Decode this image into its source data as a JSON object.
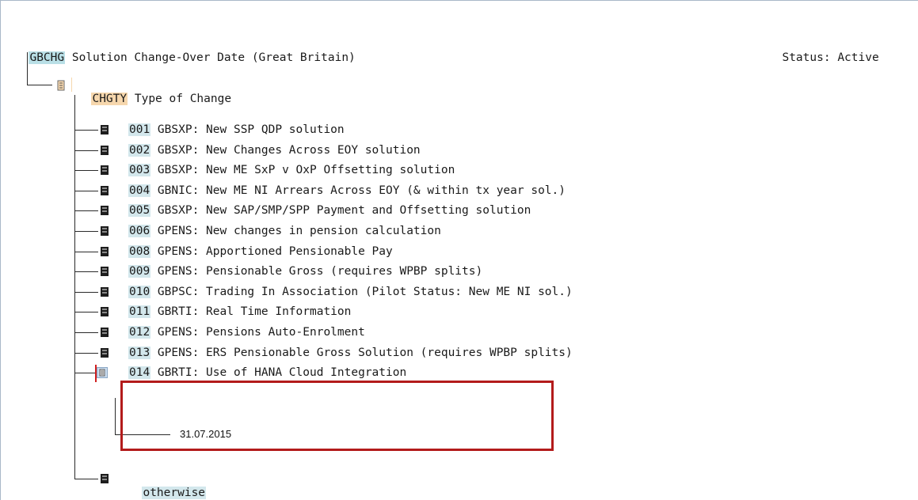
{
  "header": {
    "root_key": "GBCHG",
    "root_text": " Solution Change-Over Date (Great Britain)",
    "status_label": "Status:",
    "status_value": "Active"
  },
  "chgty": {
    "key": "CHGTY",
    "text": " Type of Change"
  },
  "options": [
    {
      "code": "001",
      "text": " GBSXP: New SSP QDP solution"
    },
    {
      "code": "002",
      "text": " GBSXP: New Changes Across EOY solution"
    },
    {
      "code": "003",
      "text": " GBSXP: New ME SxP v OxP Offsetting solution"
    },
    {
      "code": "004",
      "text": " GBNIC: New ME NI Arrears Across EOY (& within tx year sol.)"
    },
    {
      "code": "005",
      "text": " GBSXP: New SAP/SMP/SPP Payment and Offsetting solution"
    },
    {
      "code": "006",
      "text": " GPENS: New changes in pension calculation"
    },
    {
      "code": "008",
      "text": " GPENS: Apportioned Pensionable Pay"
    },
    {
      "code": "009",
      "text": " GPENS: Pensionable Gross (requires WPBP splits)"
    },
    {
      "code": "010",
      "text": " GBPSC: Trading In Association (Pilot Status: New ME NI sol.)"
    },
    {
      "code": "011",
      "text": " GBRTI: Real Time Information"
    },
    {
      "code": "012",
      "text": " GPENS: Pensions Auto-Enrolment"
    },
    {
      "code": "013",
      "text": " GPENS: ERS Pensionable Gross Solution (requires WPBP splits)"
    },
    {
      "code": "014",
      "text": " GBRTI: Use of HANA Cloud Integration"
    }
  ],
  "selected_date": "31.07.2015",
  "otherwise": "otherwise"
}
